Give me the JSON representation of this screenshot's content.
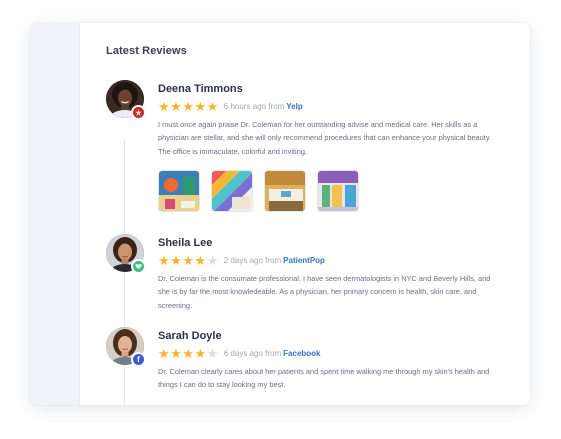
{
  "section_title": "Latest Reviews",
  "colors": {
    "star_filled": "#f5b626",
    "star_empty": "#d9dce3",
    "link": "#2f73d9",
    "yelp": "#d32323",
    "patientpop": "#34c37a",
    "facebook": "#3b5bd8"
  },
  "reviews": [
    {
      "name": "Deena Timmons",
      "rating": 5,
      "time": "6 hours ago from",
      "source": "Yelp",
      "source_icon": "yelp-icon",
      "text": "I must once again praise Dr. Coleman for her outstanding advise and medical care. Her skills as a physician are stellar, and she will only recommend procedures that can enhance your physical beauty. The office is immaculate, colorful and inviting.",
      "photos": [
        "office-photo-1",
        "office-photo-2",
        "office-photo-3",
        "office-photo-4"
      ]
    },
    {
      "name": "Sheila Lee",
      "rating": 4,
      "time": "2 days ago from",
      "source": "PatientPop",
      "source_icon": "patientpop-icon",
      "text": "Dr. Coleman is the consumate professional. I have seen dermatologists in NYC and Beverly Hills, and she is by far the most knowledeable. As a physician, her primary concern is health, skin care, and screening."
    },
    {
      "name": "Sarah Doyle",
      "rating": 4,
      "time": "6 days ago from",
      "source": "Facebook",
      "source_icon": "facebook-icon",
      "text": "Dr. Coleman clearly cares about her patients and spent time walking me through my skin's health and things I can do to stay looking my best."
    }
  ]
}
